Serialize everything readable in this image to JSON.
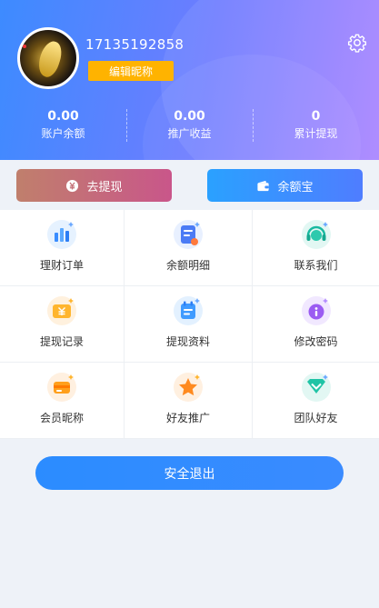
{
  "profile": {
    "phone": "17135192858",
    "edit_label": "编辑昵称",
    "settings_icon": "gear-icon"
  },
  "stats": [
    {
      "value": "0.00",
      "label": "账户余额"
    },
    {
      "value": "0.00",
      "label": "推广收益"
    },
    {
      "value": "0",
      "label": "累计提现"
    }
  ],
  "actions": {
    "withdraw": {
      "label": "去提现",
      "icon": "yuan-coin-icon"
    },
    "yeb": {
      "label": "余额宝",
      "icon": "wallet-icon"
    }
  },
  "menu": [
    {
      "label": "理财订单",
      "icon": "bar-chart-icon"
    },
    {
      "label": "余额明细",
      "icon": "document-icon"
    },
    {
      "label": "联系我们",
      "icon": "headset-icon"
    },
    {
      "label": "提现记录",
      "icon": "yuan-ticket-icon"
    },
    {
      "label": "提现资料",
      "icon": "calendar-icon"
    },
    {
      "label": "修改密码",
      "icon": "info-icon"
    },
    {
      "label": "会员昵称",
      "icon": "member-card-icon"
    },
    {
      "label": "好友推广",
      "icon": "star-icon"
    },
    {
      "label": "团队好友",
      "icon": "shield-check-icon"
    }
  ],
  "logout_label": "安全退出",
  "colors": {
    "header_start": "#3d8bff",
    "header_end": "#a884ff",
    "edit_button": "#ffb300",
    "logout_button": "#2b8cff"
  }
}
